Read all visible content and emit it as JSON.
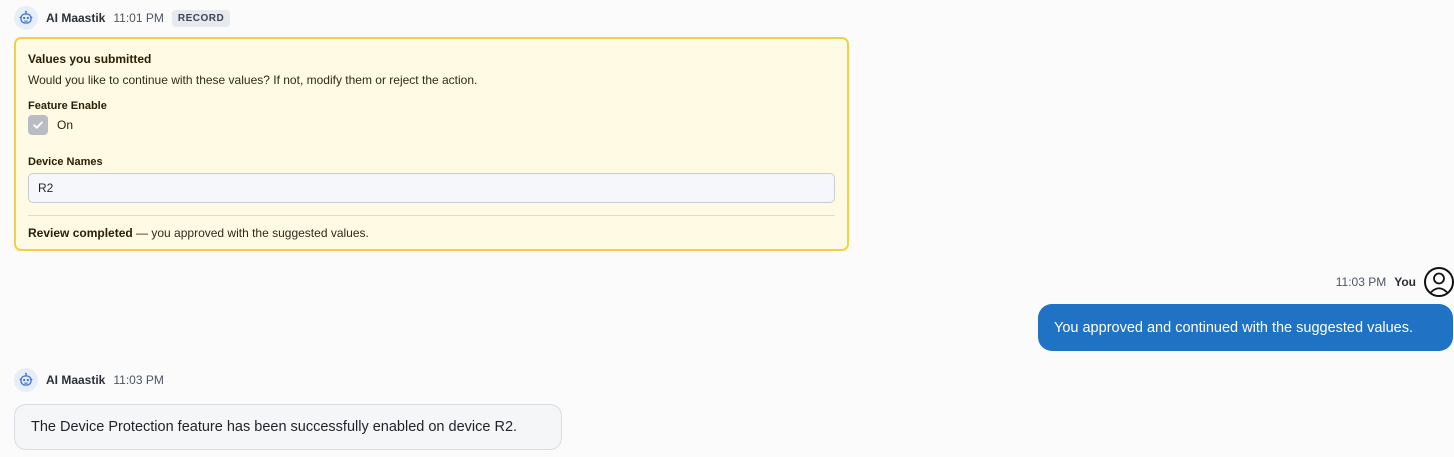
{
  "message1": {
    "sender": "AI Maastik",
    "time": "11:01 PM",
    "badge": "RECORD",
    "avatar_icon": "robot-icon",
    "review": {
      "title": "Values you submitted",
      "description": "Would you like to continue with these values? If not, modify them or reject the action.",
      "feature_enable_label": "Feature Enable",
      "feature_enable_checked": true,
      "feature_enable_value_label": "On",
      "device_names_label": "Device Names",
      "device_names_value": "R2",
      "status_bold": "Review completed",
      "status_rest": " — you approved with the suggested values."
    }
  },
  "message2": {
    "time": "11:03 PM",
    "sender": "You",
    "avatar_icon": "user-icon",
    "text": "You approved and continued with the suggested values."
  },
  "message3": {
    "sender": "AI Maastik",
    "time": "11:03 PM",
    "avatar_icon": "robot-icon",
    "text": "The Device Protection feature has been successfully enabled on device R2."
  },
  "colors": {
    "user_bubble": "#1f72c4",
    "review_card_bg": "#fffae3",
    "review_card_border": "#f2cf4a",
    "bot_bubble_bg": "#f5f6f8"
  }
}
